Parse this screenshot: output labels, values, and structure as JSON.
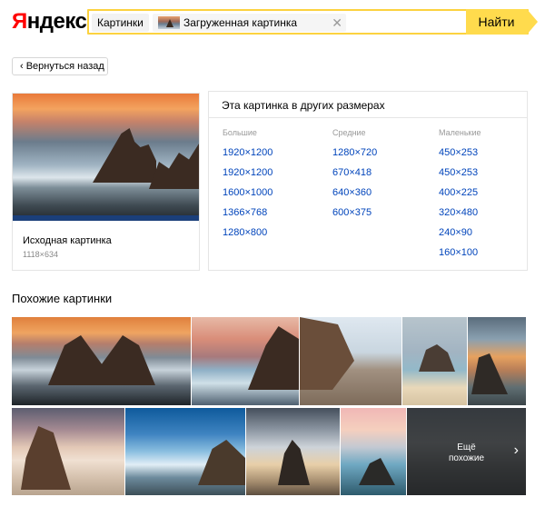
{
  "header": {
    "logo_first": "Я",
    "logo_rest": "ндекс",
    "tab_label": "Картинки",
    "uploaded_label": "Загруженная картинка",
    "close_glyph": "✕",
    "find_label": "Найти"
  },
  "back_label": "‹  Вернуться назад",
  "original": {
    "caption": "Исходная картинка",
    "dims": "1118×634"
  },
  "sizes": {
    "title": "Эта картинка в других размерах",
    "columns": [
      {
        "header": "Большие",
        "items": [
          "1920×1200",
          "1920×1200",
          "1600×1000",
          "1366×768",
          "1280×800"
        ]
      },
      {
        "header": "Средние",
        "items": [
          "1280×720",
          "670×418",
          "640×360",
          "600×375"
        ]
      },
      {
        "header": "Маленькие",
        "items": [
          "450×253",
          "450×253",
          "400×225",
          "320×480",
          "240×90",
          "160×100"
        ]
      }
    ]
  },
  "similar": {
    "title": "Похожие картинки",
    "more_line1": "Ещё",
    "more_line2": "похожие",
    "more_arrow": "›"
  }
}
